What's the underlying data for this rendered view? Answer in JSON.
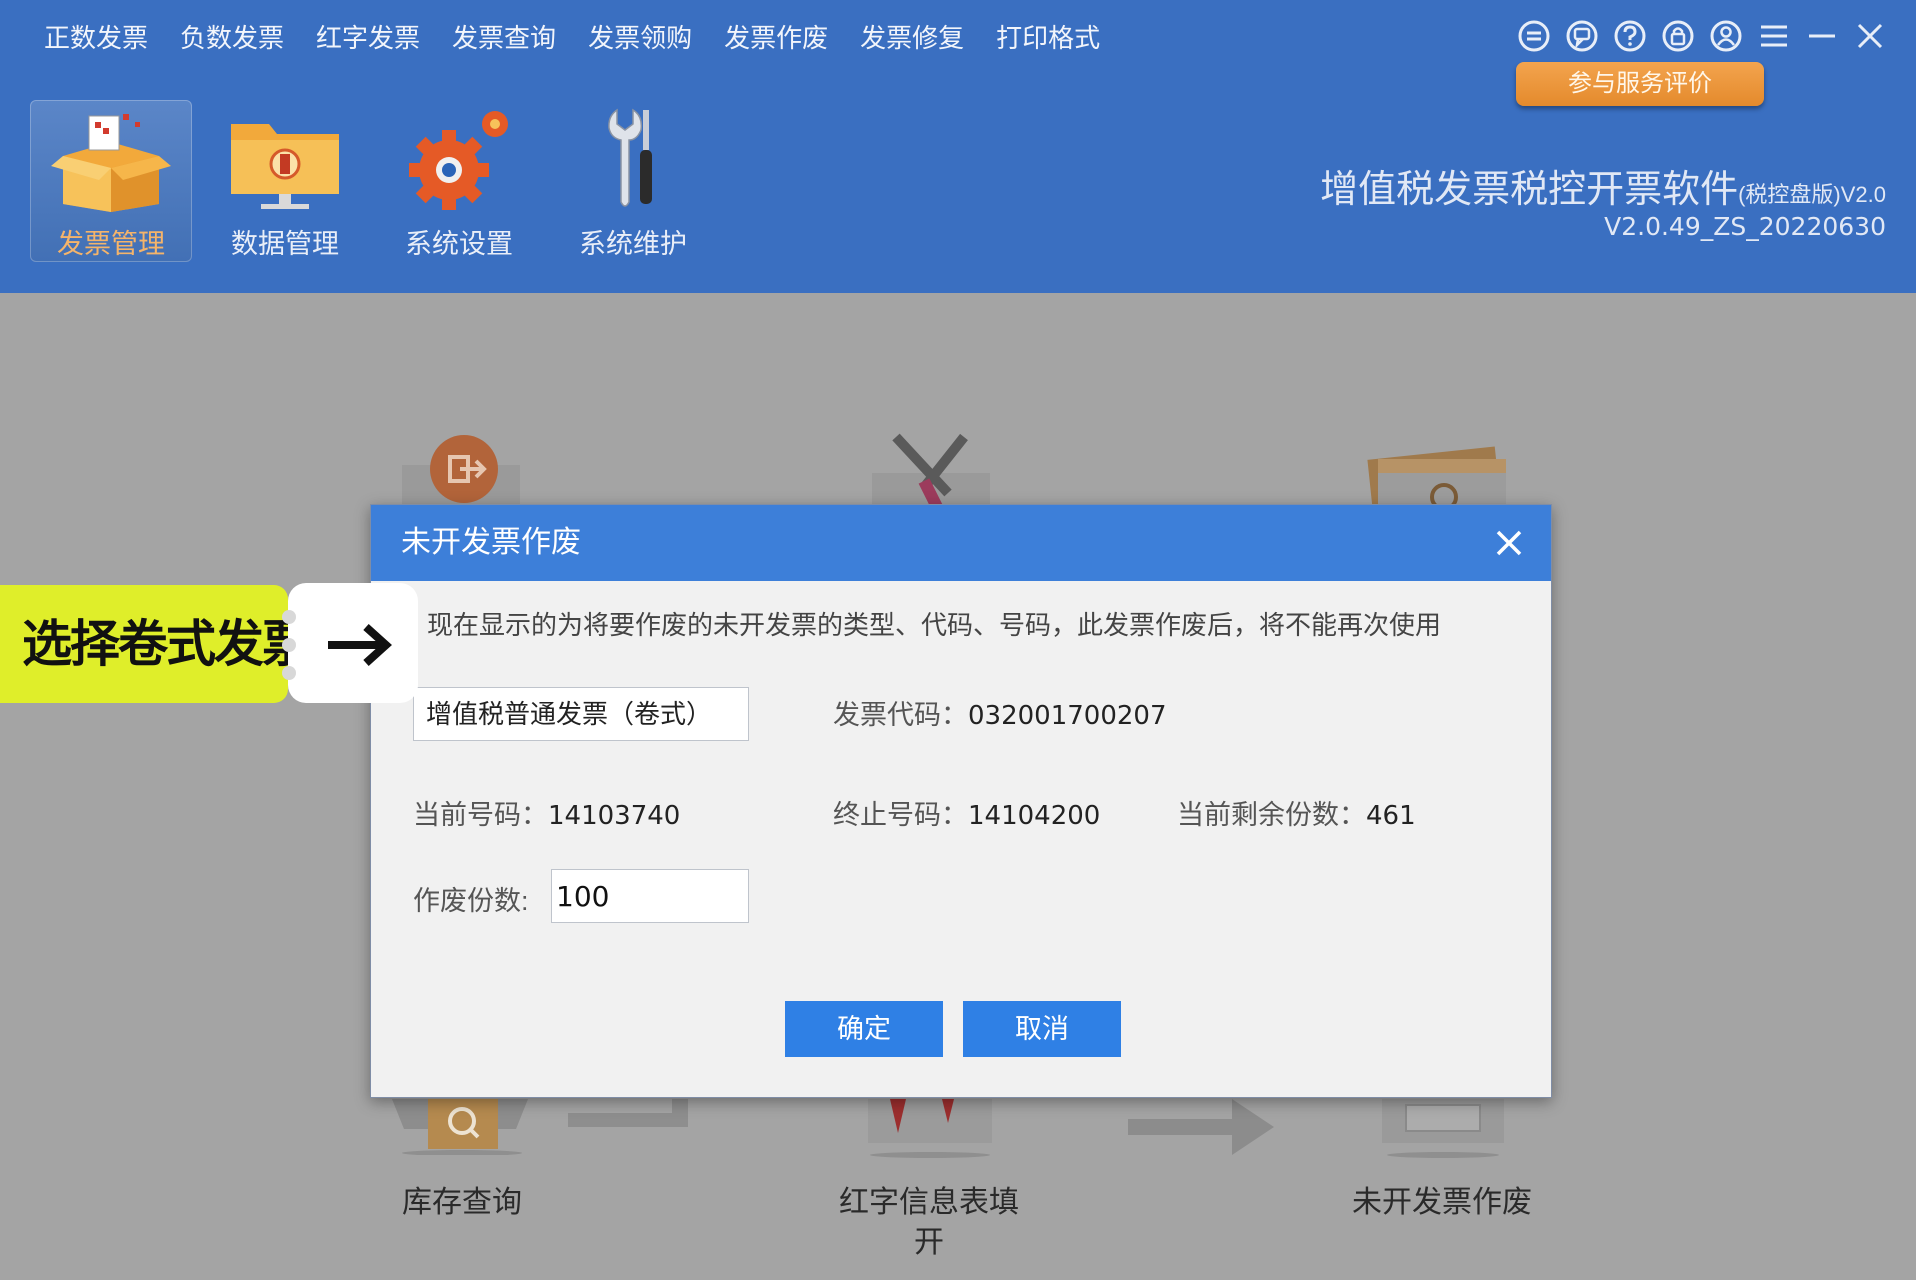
{
  "menu": {
    "items": [
      "正数发票",
      "负数发票",
      "红字发票",
      "发票查询",
      "发票领购",
      "发票作废",
      "发票修复",
      "打印格式"
    ]
  },
  "window_controls": {
    "icons": [
      "minus-circle-icon",
      "chat-icon",
      "help-icon",
      "lock-icon",
      "user-icon",
      "menu-icon",
      "minimize-icon",
      "close-icon"
    ]
  },
  "service_eval": {
    "label": "参与服务评价"
  },
  "nav": {
    "items": [
      {
        "label": "发票管理",
        "icon": "invoice-box-icon",
        "active": true
      },
      {
        "label": "数据管理",
        "icon": "data-folder-icon",
        "active": false
      },
      {
        "label": "系统设置",
        "icon": "gear-icon",
        "active": false
      },
      {
        "label": "系统维护",
        "icon": "wrench-icon",
        "active": false
      }
    ]
  },
  "app": {
    "title": "增值税发票税控开票软件",
    "edition": "(税控盘版)V2.0",
    "version": "V2.0.49_ZS_20220630"
  },
  "workspace": {
    "functions": [
      "库存查询",
      "红字信息表填开",
      "未开发票作废"
    ]
  },
  "dialog": {
    "title": "未开发票作废",
    "notice": "现在显示的为将要作废的未开发票的类型、代码、号码，此发票作废后，将不能再次使用",
    "invoice_type": "增值税普通发票（卷式）",
    "code_label": "发票代码：",
    "code_value": "032001700207",
    "current_no_label": "当前号码：",
    "current_no_value": "14103740",
    "end_no_label": "终止号码：",
    "end_no_value": "14104200",
    "remaining_label": "当前剩余份数：",
    "remaining_value": "461",
    "quantity_label": "作废份数:",
    "quantity_value": "100",
    "confirm_label": "确定",
    "cancel_label": "取消"
  },
  "callout": {
    "text": "选择卷式发票",
    "arrow": "→"
  },
  "colors": {
    "topbar": "#3a6fc1",
    "dialog_header": "#3d7fd9",
    "primary_button": "#2f80e5",
    "eval_button": "#e99537",
    "callout": "#dfee2a",
    "overlay": "#a4a4a4"
  }
}
